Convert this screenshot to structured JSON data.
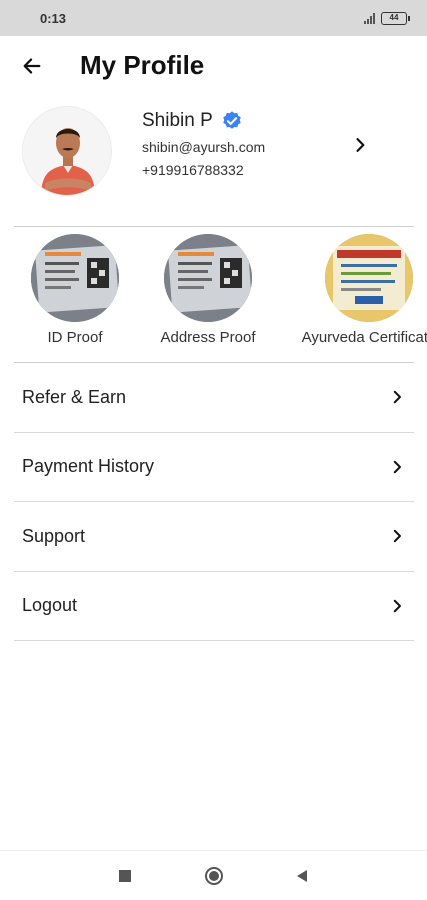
{
  "status_bar": {
    "time": "0:13",
    "battery": "44"
  },
  "header": {
    "title": "My Profile"
  },
  "profile": {
    "name": "Shibin P",
    "email": "shibin@ayursh.com",
    "phone": "+919916788332"
  },
  "documents": [
    {
      "label": "ID Proof"
    },
    {
      "label": "Address Proof"
    },
    {
      "label": "Ayurveda Certificate"
    }
  ],
  "menu": [
    {
      "label": "Refer & Earn"
    },
    {
      "label": "Payment History"
    },
    {
      "label": "Support"
    },
    {
      "label": "Logout"
    }
  ],
  "colors": {
    "verified": "#3b82f6",
    "divider": "#cfcfcf",
    "status_bar": "#d9d9d9"
  }
}
